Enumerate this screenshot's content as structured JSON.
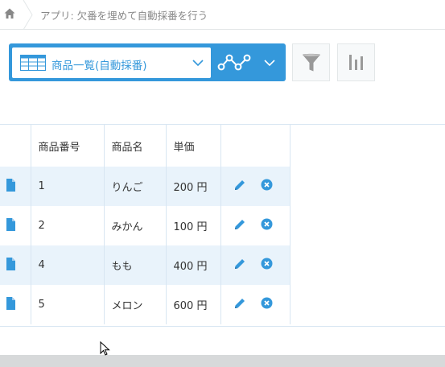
{
  "breadcrumb": {
    "home_icon": "home-icon",
    "app_title": "アプリ: 欠番を埋めて自動採番を行う"
  },
  "toolbar": {
    "view_name": "商品一覧(自動採番)",
    "view_icon": "table-grid-icon",
    "graph_icon": "line-graph-icon",
    "filter_icon": "funnel-icon",
    "chart_icon": "bar-chart-icon",
    "accent_color": "#3498db"
  },
  "table": {
    "columns": [
      "商品番号",
      "商品名",
      "単価"
    ],
    "rows": [
      {
        "number": "1",
        "name": "りんご",
        "price": "200 円"
      },
      {
        "number": "2",
        "name": "みかん",
        "price": "100 円"
      },
      {
        "number": "4",
        "name": "もも",
        "price": "400 円"
      },
      {
        "number": "5",
        "name": "メロン",
        "price": "600 円"
      }
    ]
  }
}
